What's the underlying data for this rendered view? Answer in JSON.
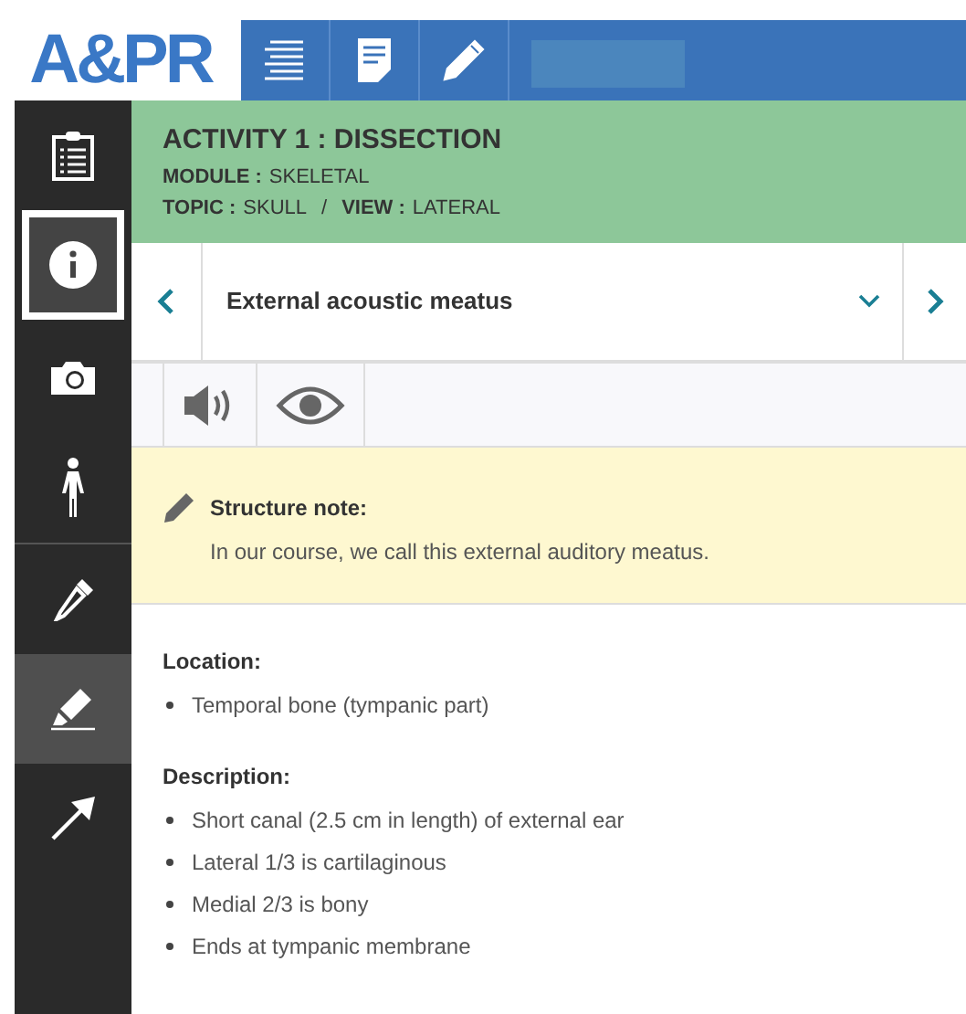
{
  "logo": "A&PR",
  "toolbar": [
    {
      "kind": "list"
    },
    {
      "kind": "note"
    },
    {
      "kind": "pencil"
    }
  ],
  "sidebar": {
    "items": [
      {
        "kind": "clipboard",
        "selected": false,
        "active": false
      },
      {
        "kind": "info",
        "selected": true,
        "active": false
      },
      {
        "kind": "camera",
        "selected": false,
        "active": false
      },
      {
        "kind": "body",
        "selected": false,
        "active": false
      },
      {
        "kind": "dropper",
        "selected": false,
        "active": false
      },
      {
        "kind": "highlighter",
        "selected": false,
        "active": true
      },
      {
        "kind": "arrow",
        "selected": false,
        "active": false
      }
    ]
  },
  "activity": {
    "title": "ACTIVITY 1 : DISSECTION",
    "module_label": "MODULE :",
    "module": "SKELETAL",
    "topic_label": "TOPIC :",
    "topic": "SKULL",
    "separator": "/",
    "view_label": "VIEW :",
    "view": "LATERAL"
  },
  "structure_select": {
    "value": "External acoustic meatus"
  },
  "tools": [
    {
      "kind": "audio"
    },
    {
      "kind": "eye"
    }
  ],
  "note": {
    "title": "Structure note:",
    "text": "In our course, we call this external auditory meatus."
  },
  "sections": [
    {
      "heading": "Location:",
      "items": [
        "Temporal bone (tympanic part)"
      ]
    },
    {
      "heading": "Description:",
      "items": [
        "Short canal (2.5 cm in length) of external ear",
        "Lateral 1/3 is cartilaginous",
        "Medial 2/3 is bony",
        "Ends at tympanic membrane"
      ]
    }
  ]
}
